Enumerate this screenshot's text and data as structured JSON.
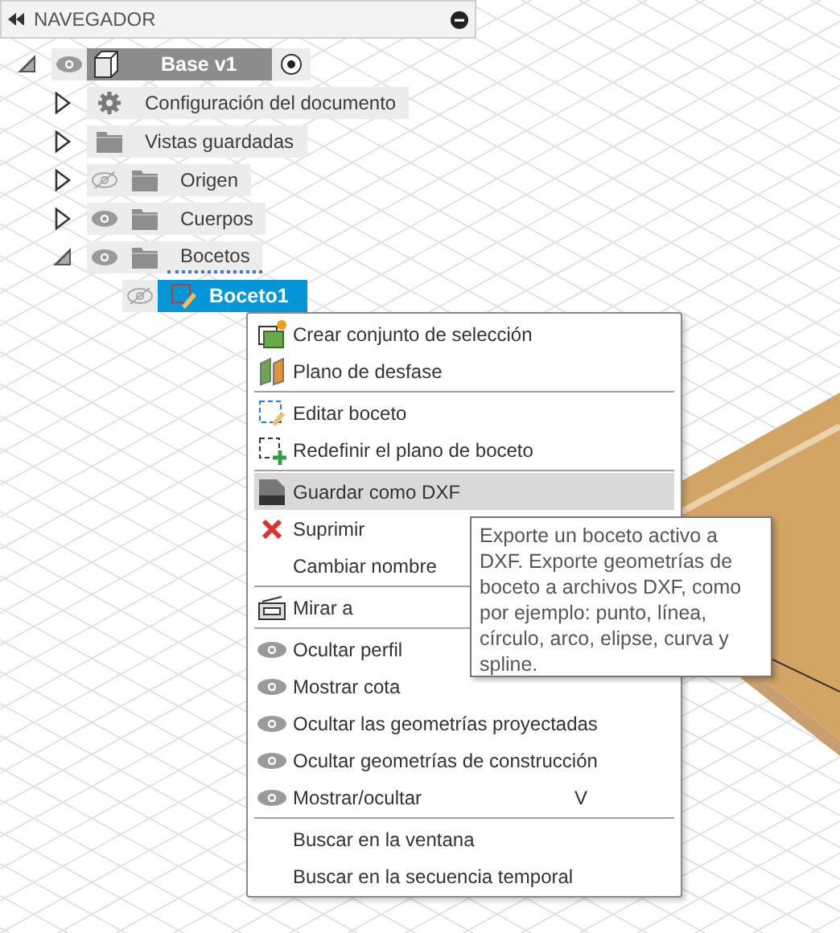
{
  "navigator": {
    "title": "NAVEGADOR",
    "tree": [
      {
        "label": "Base v1",
        "kind": "component",
        "visible": true,
        "expanded": true,
        "active": true,
        "children": [
          {
            "label": "Configuración del documento",
            "kind": "settings",
            "expanded": false
          },
          {
            "label": "Vistas guardadas",
            "kind": "folder",
            "expanded": false
          },
          {
            "label": "Origen",
            "kind": "folder",
            "visible": false,
            "expanded": false
          },
          {
            "label": "Cuerpos",
            "kind": "folder",
            "visible": true,
            "expanded": false
          },
          {
            "label": "Bocetos",
            "kind": "folder",
            "visible": true,
            "expanded": true,
            "children": [
              {
                "label": "Boceto1",
                "kind": "sketch",
                "visible": false,
                "selected": true
              }
            ]
          }
        ]
      }
    ]
  },
  "context_menu": {
    "items": [
      {
        "kind": "item",
        "label": "Crear conjunto de selección",
        "selected": false
      },
      {
        "kind": "item",
        "label": "Plano de desfase",
        "selected": false
      },
      {
        "kind": "separator"
      },
      {
        "kind": "item",
        "label": "Editar boceto",
        "selected": false
      },
      {
        "kind": "item",
        "label": "Redefinir el plano de boceto",
        "selected": false
      },
      {
        "kind": "separator"
      },
      {
        "kind": "item",
        "label": "Guardar como DXF",
        "selected": true
      },
      {
        "kind": "item",
        "label": "Suprimir",
        "selected": false
      },
      {
        "kind": "item",
        "label": "Cambiar nombre",
        "selected": false
      },
      {
        "kind": "separator"
      },
      {
        "kind": "item",
        "label": "Mirar a",
        "selected": false
      },
      {
        "kind": "separator"
      },
      {
        "kind": "item",
        "label": "Ocultar perfil",
        "selected": false
      },
      {
        "kind": "item",
        "label": "Mostrar cota",
        "selected": false
      },
      {
        "kind": "item",
        "label": "Ocultar las geometrías proyectadas",
        "selected": false
      },
      {
        "kind": "item",
        "label": "Ocultar geometrías de construcción",
        "selected": false
      },
      {
        "kind": "item",
        "label": "Mostrar/ocultar",
        "shortcut": "V",
        "selected": false
      },
      {
        "kind": "separator"
      },
      {
        "kind": "item",
        "label": "Buscar en la ventana",
        "selected": false
      },
      {
        "kind": "item",
        "label": "Buscar en la secuencia temporal",
        "selected": false
      }
    ]
  },
  "tooltip": {
    "text": "Exporte un boceto activo a DXF. Exporte geometrías de boceto a archivos DXF, como por ejemplo: punto, línea, círculo, arco, elipse, curva y spline."
  }
}
